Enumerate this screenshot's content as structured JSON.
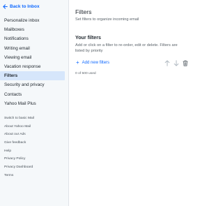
{
  "sidebar": {
    "back_label": "Back to Inbox",
    "items": [
      {
        "label": "Personalize inbox",
        "active": false
      },
      {
        "label": "Mailboxes",
        "active": false
      },
      {
        "label": "Notifications",
        "active": false
      },
      {
        "label": "Writing email",
        "active": false
      },
      {
        "label": "Viewing email",
        "active": false
      },
      {
        "label": "Vacation response",
        "active": false
      },
      {
        "label": "Filters",
        "active": true
      },
      {
        "label": "Security and privacy",
        "active": false
      },
      {
        "label": "Contacts",
        "active": false
      },
      {
        "label": "Yahoo Mail Plus",
        "active": false
      }
    ],
    "footer_links": [
      "Switch to basic Mail",
      "About Yahoo Mail",
      "About our Ads",
      "Give feedback",
      "Help",
      "Privacy Policy",
      "Privacy Dashboard",
      "Terms"
    ]
  },
  "main": {
    "title": "Filters",
    "subtitle": "Set filters to organize incoming email",
    "section_title": "Your filters",
    "description": "Add or click on a filter to re-order, edit or delete. Filters are listed by priority",
    "add_label": "Add new filters",
    "count_text": "0 of 500 used"
  },
  "icons": {
    "back": "arrow-left-icon",
    "add": "plus-icon",
    "move_up": "arrow-up-icon",
    "move_down": "arrow-down-icon",
    "delete": "trash-icon"
  },
  "colors": {
    "accent": "#0f69ff",
    "sidebar_bg": "#f5f8fa",
    "active_bg": "#d6e6fb",
    "text": "#232a31",
    "muted": "#5b636a"
  }
}
